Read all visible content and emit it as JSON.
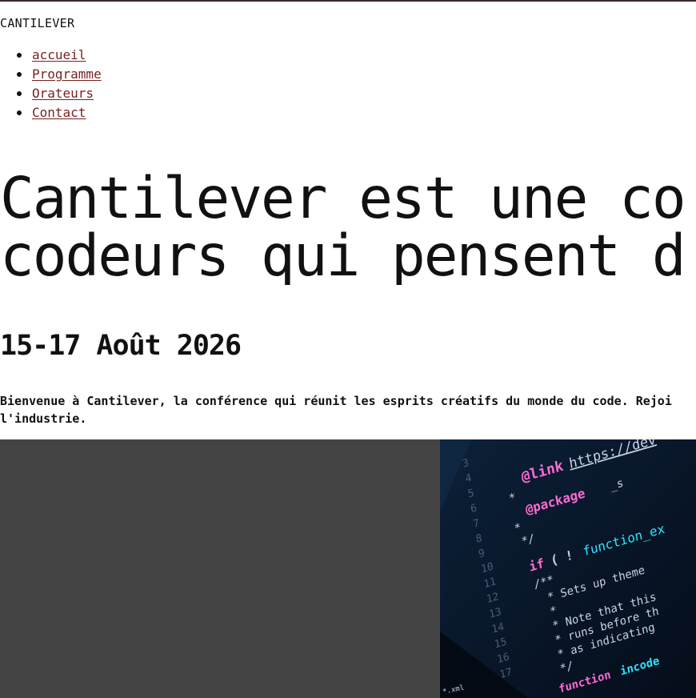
{
  "header": {
    "brand": "CANTILEVER"
  },
  "nav": {
    "items": [
      {
        "label": "accueil"
      },
      {
        "label": "Programme"
      },
      {
        "label": "Orateurs"
      },
      {
        "label": "Contact"
      }
    ]
  },
  "hero": {
    "headline_line1": "Cantilever est une co",
    "headline_line2": "codeurs qui pensent d",
    "date": "15-17 Août 2026",
    "intro_line1": "Bienvenue à Cantilever, la conférence qui réunit les esprits créatifs du monde du code. Rejoi",
    "intro_line2": "l'industrie."
  },
  "code_image": {
    "line_numbers": [
      "3",
      "4",
      "5",
      "6",
      "7",
      "8",
      "9",
      "10",
      "11",
      "12",
      "13",
      "14",
      "15",
      "16",
      "17"
    ],
    "link_tag": "@link",
    "link_url": "https://dev",
    "package_tag": "@package",
    "package_value": "_s",
    "comment_close": "*/",
    "if_keyword": "if",
    "if_parens": "( !",
    "function_name": "function_ex",
    "doc_open": "/**",
    "doc_line1": "* Sets up theme",
    "doc_line2": "* Note that this",
    "doc_line3": "* runs before th",
    "doc_line4": "* as indicating",
    "doc_close": "*/",
    "function_keyword": "function",
    "function_call": "incode",
    "footer_fragment": "*.xml",
    "colors": {
      "pink": "#ff6ad5",
      "cyan": "#2ee6ff",
      "comment": "#c9d3e6",
      "line_number": "#4a5c78",
      "background": "#08162a"
    }
  }
}
